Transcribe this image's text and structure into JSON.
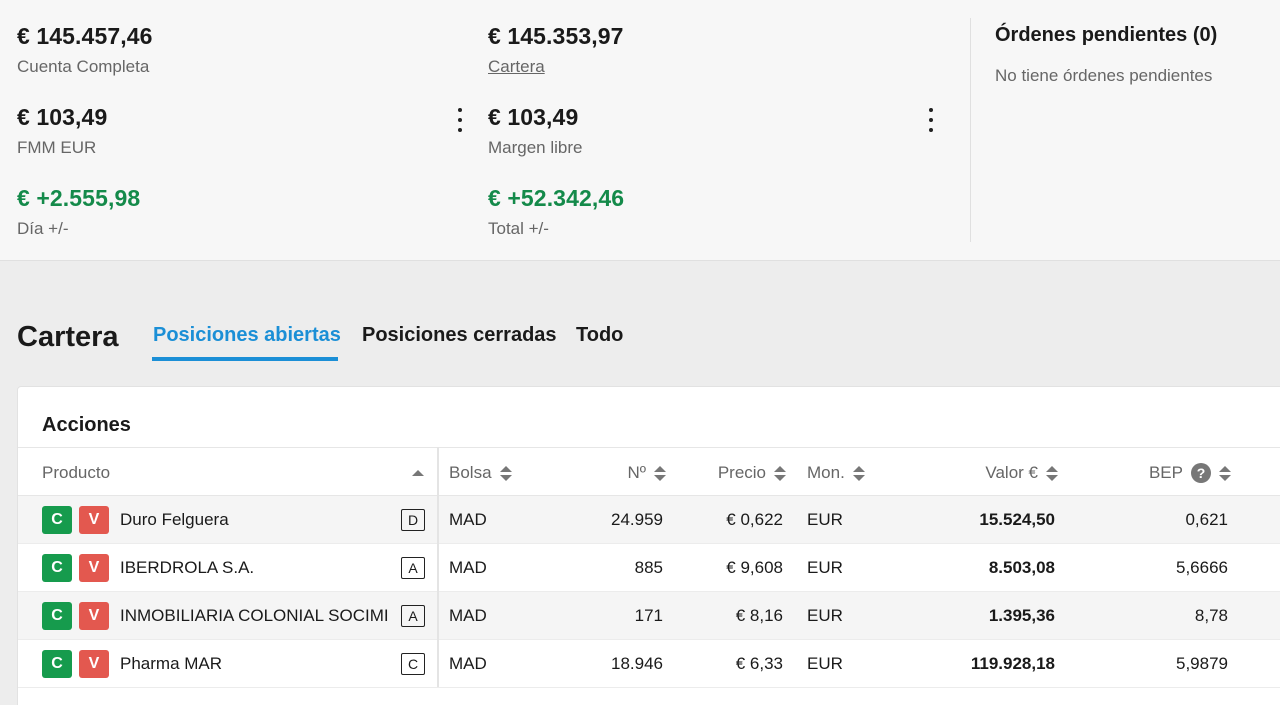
{
  "summary": {
    "cuenta_completa": {
      "value": "€ 145.457,46",
      "label": "Cuenta Completa"
    },
    "cartera": {
      "value": "€ 145.353,97",
      "label": "Cartera"
    },
    "fmm": {
      "value": "€ 103,49",
      "label": "FMM EUR"
    },
    "margen_libre": {
      "value": "€ 103,49",
      "label": "Margen libre"
    },
    "dia": {
      "value": "€ +2.555,98",
      "label": "Día +/-"
    },
    "total": {
      "value": "€ +52.342,46",
      "label": "Total +/-"
    }
  },
  "orders": {
    "title": "Órdenes pendientes (0)",
    "empty_text": "No tiene órdenes pendientes"
  },
  "portfolio": {
    "title": "Cartera",
    "tabs": [
      {
        "label": "Posiciones abiertas",
        "active": true
      },
      {
        "label": "Posiciones cerradas",
        "active": false
      },
      {
        "label": "Todo",
        "active": false
      }
    ]
  },
  "table": {
    "title": "Acciones",
    "columns": {
      "producto": "Producto",
      "bolsa": "Bolsa",
      "numero": "Nº",
      "precio": "Precio",
      "moneda": "Mon.",
      "valor": "Valor €",
      "bep": "BEP",
      "help": "?"
    },
    "buy_label": "C",
    "sell_label": "V",
    "rows": [
      {
        "producto": "Duro Felguera",
        "badge": "D",
        "bolsa": "MAD",
        "numero": "24.959",
        "precio": "€ 0,622",
        "moneda": "EUR",
        "valor": "15.524,50",
        "bep": "0,621"
      },
      {
        "producto": "IBERDROLA S.A.",
        "badge": "A",
        "bolsa": "MAD",
        "numero": "885",
        "precio": "€ 9,608",
        "moneda": "EUR",
        "valor": "8.503,08",
        "bep": "5,6666"
      },
      {
        "producto": "INMOBILIARIA COLONIAL SOCIMI",
        "badge": "A",
        "bolsa": "MAD",
        "numero": "171",
        "precio": "€ 8,16",
        "moneda": "EUR",
        "valor": "1.395,36",
        "bep": "8,78"
      },
      {
        "producto": "Pharma MAR",
        "badge": "C",
        "bolsa": "MAD",
        "numero": "18.946",
        "precio": "€ 6,33",
        "moneda": "EUR",
        "valor": "119.928,18",
        "bep": "5,9879"
      }
    ]
  },
  "colors": {
    "positive": "#148a4a",
    "accent": "#1b8fd6",
    "buy": "#169b4d",
    "sell": "#e3584f"
  }
}
